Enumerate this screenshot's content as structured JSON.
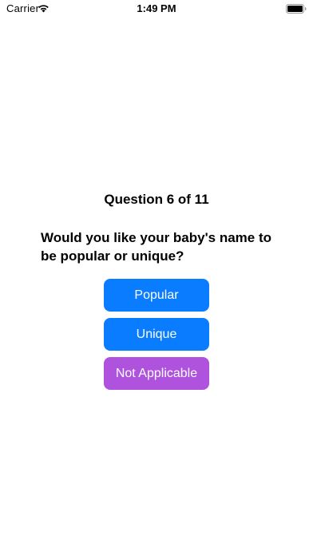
{
  "status_bar": {
    "carrier": "Carrier",
    "time": "1:49 PM",
    "icons": [
      "wifi-icon",
      "battery-icon"
    ]
  },
  "quiz": {
    "counter": "Question 6 of 11",
    "question": "Would you like your baby's name to be popular or unique?",
    "answers": [
      {
        "label": "Popular",
        "color": "#0a7cff"
      },
      {
        "label": "Unique",
        "color": "#0a7cff"
      },
      {
        "label": "Not Applicable",
        "color": "#af52de"
      }
    ]
  }
}
